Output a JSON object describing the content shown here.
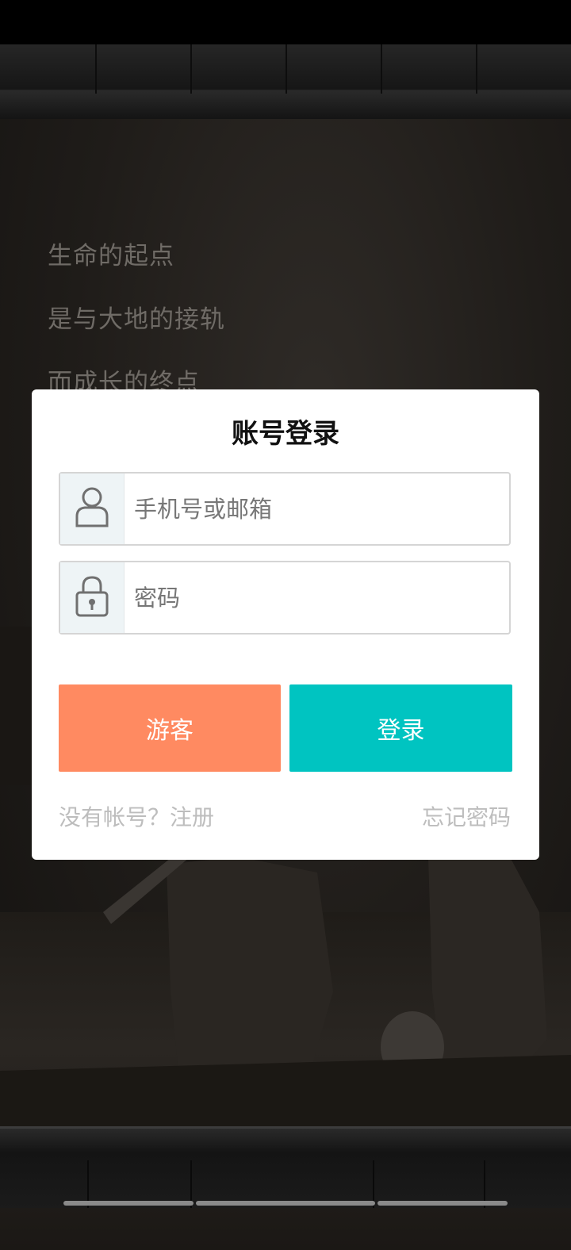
{
  "background": {
    "poem_lines": [
      "生命的起点",
      "是与大地的接轨",
      "而成长的终点"
    ]
  },
  "dialog": {
    "title": "账号登录",
    "account_placeholder": "手机号或邮箱",
    "account_icon": "user-icon",
    "password_placeholder": "密码",
    "password_icon": "lock-icon",
    "guest_label": "游客",
    "login_label": "登录",
    "register_link": "没有帐号？注册",
    "forgot_link": "忘记密码"
  },
  "colors": {
    "guest_button": "#ff8a61",
    "login_button": "#00c4c1",
    "icon_box": "#eef4f6"
  }
}
